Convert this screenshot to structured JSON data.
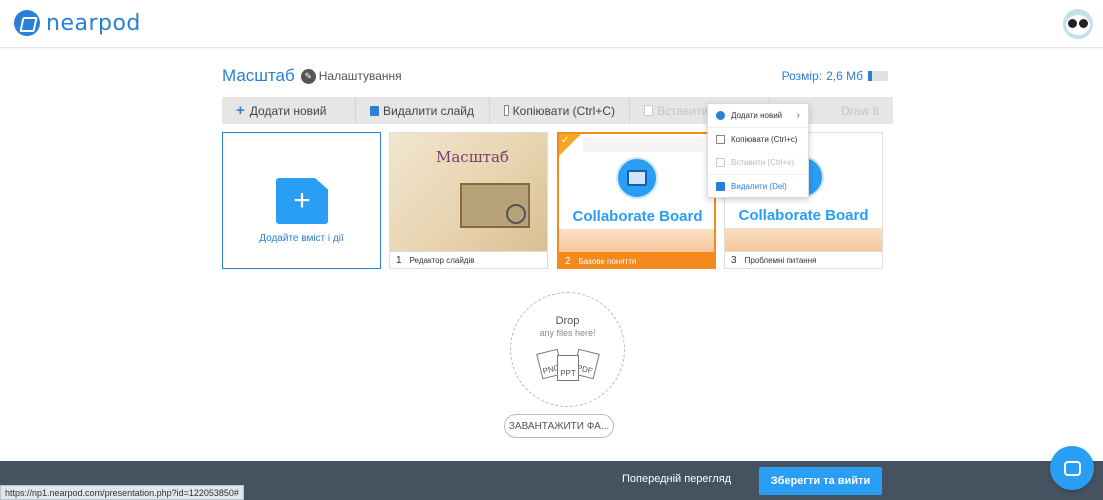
{
  "app": {
    "logo_text": "nearpod"
  },
  "header": {
    "title": "Масштаб",
    "settings_label": "Налаштування",
    "size_label": "Розмір:",
    "size_value": "2,6 Мб",
    "size_fraction": 0.2
  },
  "toolbar": {
    "add_label": "Додати новий",
    "delete_label": "Видалити слайд",
    "copy_label": "Копіювати (Ctrl+C)",
    "paste_label": "Вставити (Ctrl+V)",
    "draw_label": "Draw It"
  },
  "add_card": {
    "caption": "Додайте вміст і дії"
  },
  "slides": [
    {
      "number": "1",
      "label": "Редактор слайдів",
      "thumb_title": "Масштаб"
    },
    {
      "number": "2",
      "label": "Базове поняття",
      "thumb_title": "Collaborate Board"
    },
    {
      "number": "3",
      "label": "Проблемні питання",
      "thumb_title": "Collaborate Board"
    }
  ],
  "context_menu": {
    "items": [
      {
        "label": "Додати новий",
        "icon": "plus-circle-icon"
      },
      {
        "label": "Копіювати (Ctrl+c)",
        "icon": "copy-icon"
      },
      {
        "label": "Вставити (Ctrl+v)",
        "icon": "paste-icon"
      },
      {
        "label": "Видалити (Del)",
        "icon": "trash-icon"
      }
    ]
  },
  "dropzone": {
    "title": "Drop",
    "subtitle": "any files here!",
    "types": [
      "PNG",
      "PPT",
      "PDF"
    ],
    "upload_label": "ЗАВАНТАЖИТИ ФА..."
  },
  "footer": {
    "preview_label": "Попередній перегляд",
    "save_label": "Зберегти та вийти",
    "status_url": "https://np1.nearpod.com/presentation.php?id=122053850#"
  },
  "colors": {
    "brand": "#2a7fd6",
    "accent": "#2a9df4",
    "selected": "#f28a1e",
    "bottom_bar": "#45525f"
  }
}
